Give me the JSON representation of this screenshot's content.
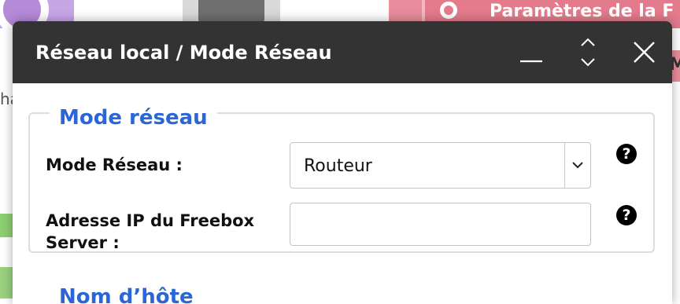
{
  "background": {
    "right_tile_label": "Paramètres de la F",
    "left_fragment": "ha",
    "right_fragment": "M"
  },
  "dialog": {
    "title": "Réseau local / Mode Réseau",
    "controls": {
      "minimize_icon": "minimize-icon",
      "expand_icon": "expand-collapse-icon",
      "close_icon": "close-icon"
    },
    "section": {
      "legend": "Mode réseau",
      "fields": {
        "mode": {
          "label": "Mode Réseau :",
          "value": "Routeur"
        },
        "ip": {
          "label_line1": "Adresse IP du Freebox",
          "label_line2": "Server :",
          "value": ""
        }
      },
      "help_glyph": "?"
    },
    "next_section_legend": "Nom d’hôte"
  },
  "colors": {
    "titlebar": "#333333",
    "accent": "#2a66d8",
    "background_pink": "#e98d9c"
  }
}
